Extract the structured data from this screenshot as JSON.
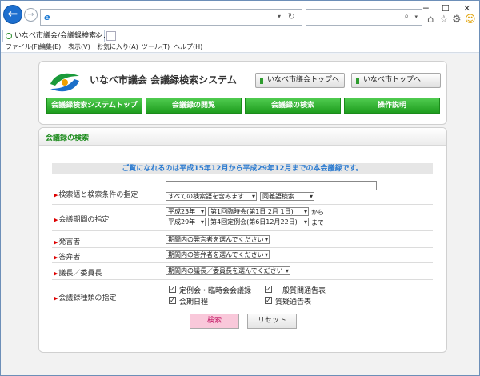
{
  "browser": {
    "address_value": "",
    "search_value": "",
    "tab_title": "いなべ市議会/会議録検索シ...",
    "menu": [
      "ファイル(F)",
      "編集(E)",
      "表示(V)",
      "お気に入り(A)",
      "ツール(T)",
      "ヘルプ(H)"
    ]
  },
  "header": {
    "site_name": "いなべ市議会  会議録検索システム",
    "link_council": "いなべ市議会トップへ",
    "link_city": "いなべ市トップへ",
    "nav": [
      "会議録検索システムトップ",
      "会議録の閲覧",
      "会議録の検索",
      "操作説明"
    ]
  },
  "main": {
    "title": "会議録の検索",
    "info": "ご覧になれるのは平成15年12月から平成29年12月までの本会議録です。",
    "rows": {
      "keyword_label": "検索語と検索条件の指定",
      "keyword_value": "",
      "keyword_mode": "すべての検索語を含みます",
      "keyword_match": "同義語検索",
      "period_label": "会議期間の指定",
      "from_year": "平成23年",
      "from_meeting": "第1回臨時会(第1日 2月 1日)",
      "from_suffix": "から",
      "to_year": "平成29年",
      "to_meeting": "第4回定例会(第6日12月22日)",
      "to_suffix": "まで",
      "speaker_label": "発言者",
      "speaker_value": "期間内の発言者を選んでください",
      "answerer_label": "答弁者",
      "answerer_value": "期間内の答弁者を選んでください",
      "chair_label": "議長／委員長",
      "chair_value": "期間内の議長／委員長を選んでください",
      "type_label": "会議録種類の指定"
    },
    "types": [
      {
        "label": "定例会・臨時会会議録",
        "checked": true
      },
      {
        "label": "一般質問通告表",
        "checked": true
      },
      {
        "label": "会期日程",
        "checked": true
      },
      {
        "label": "質疑通告表",
        "checked": true
      }
    ],
    "search_button": "検索",
    "reset_button": "リセット"
  }
}
